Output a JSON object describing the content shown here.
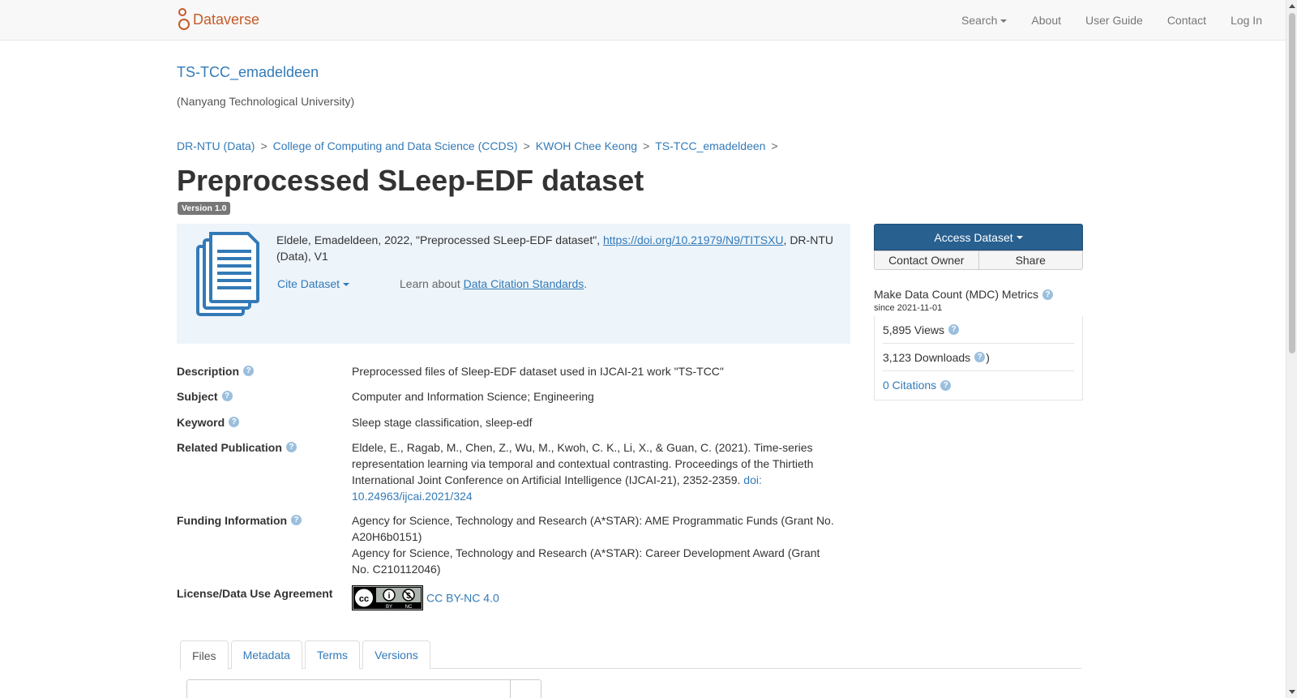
{
  "brand": {
    "name": "Dataverse"
  },
  "nav": {
    "search": "Search",
    "about": "About",
    "user_guide": "User Guide",
    "contact": "Contact",
    "login": "Log In"
  },
  "dataverse": {
    "title": "TS-TCC_emadeldeen",
    "affiliation": "(Nanyang Technological University)"
  },
  "breadcrumb": [
    "DR-NTU (Data)",
    "College of Computing and Data Science (CCDS)",
    "KWOH Chee Keong",
    "TS-TCC_emadeldeen"
  ],
  "breadcrumb_sep": ">",
  "dataset": {
    "title": "Preprocessed SLeep-EDF dataset",
    "version": "Version 1.0"
  },
  "citation": {
    "prefix": "Eldele, Emadeldeen, 2022, \"Preprocessed SLeep-EDF dataset\", ",
    "doi_link": "https://doi.org/10.21979/N9/TITSXU",
    "suffix": ", DR-NTU (Data), V1",
    "cite_button": "Cite Dataset",
    "learn_prefix": "Learn about ",
    "learn_link": "Data Citation Standards",
    "learn_suffix": "."
  },
  "actions": {
    "access": "Access Dataset",
    "contact_owner": "Contact Owner",
    "share": "Share"
  },
  "metrics": {
    "title": "Make Data Count (MDC) Metrics",
    "since": "since 2021-11-01",
    "views": "5,895 Views",
    "downloads": "3,123 Downloads",
    "downloads_close": ")",
    "citations": "0 Citations"
  },
  "metadata": {
    "description_label": "Description",
    "description": "Preprocessed files of Sleep-EDF dataset used in IJCAI-21 work \"TS-TCC\"",
    "subject_label": "Subject",
    "subject": "Computer and Information Science; Engineering",
    "keyword_label": "Keyword",
    "keyword": "Sleep stage classification, sleep-edf",
    "related_label": "Related Publication",
    "related_text": "Eldele, E., Ragab, M., Chen, Z., Wu, M., Kwoh, C. K., Li, X., & Guan, C. (2021). Time-series representation learning via temporal and contextual contrasting. Proceedings of the Thirtieth International Joint Conference on Artificial Intelligence (IJCAI-21), 2352-2359. ",
    "related_doi": "doi: 10.24963/ijcai.2021/324",
    "funding_label": "Funding Information",
    "funding_1": "Agency for Science, Technology and Research (A*STAR): AME Programmatic Funds (Grant No. A20H6b0151)",
    "funding_2": "Agency for Science, Technology and Research (A*STAR): Career Development Award (Grant No. C210112046)",
    "license_label": "License/Data Use Agreement",
    "license": "CC BY-NC 4.0",
    "license_badge_left": "BY",
    "license_badge_right": "NC"
  },
  "tabs": [
    "Files",
    "Metadata",
    "Terms",
    "Versions"
  ],
  "colors": {
    "brand": "#c55b28",
    "link": "#337ab7",
    "primary_btn": "#286090",
    "cite_bg": "#edf4fa",
    "doc_icon": "#337ab7"
  }
}
